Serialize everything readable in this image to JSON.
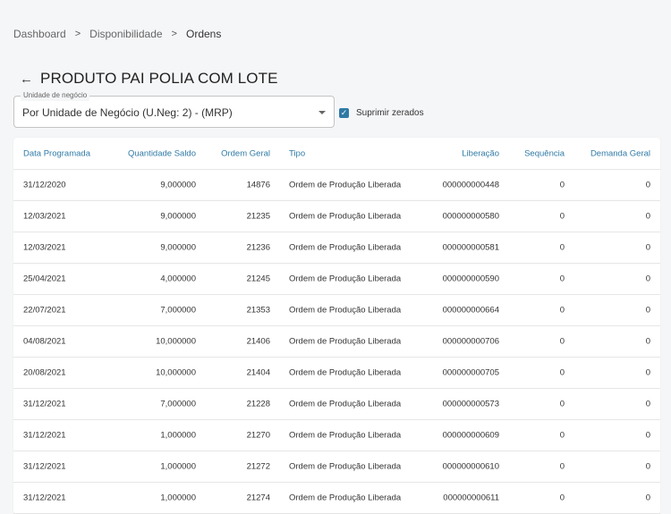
{
  "breadcrumb": [
    "Dashboard",
    "Disponibilidade",
    "Ordens"
  ],
  "page_title": "PRODUTO PAI POLIA COM LOTE",
  "unit_select": {
    "label": "Unidade de negócio",
    "value": "Por Unidade de Negócio (U.Neg: 2) - (MRP)"
  },
  "suppress_zero": {
    "label": "Suprimir zerados",
    "checked": true
  },
  "accent_color": "#2f7aa6",
  "table": {
    "headers": [
      "Data Programada",
      "Quantidade Saldo",
      "Ordem Geral",
      "Tipo",
      "Liberação",
      "Sequência",
      "Demanda Geral"
    ],
    "rows": [
      [
        "31/12/2020",
        "9,000000",
        "14876",
        "Ordem de Produção Liberada",
        "000000000448",
        "0",
        "0"
      ],
      [
        "12/03/2021",
        "9,000000",
        "21235",
        "Ordem de Produção Liberada",
        "000000000580",
        "0",
        "0"
      ],
      [
        "12/03/2021",
        "9,000000",
        "21236",
        "Ordem de Produção Liberada",
        "000000000581",
        "0",
        "0"
      ],
      [
        "25/04/2021",
        "4,000000",
        "21245",
        "Ordem de Produção Liberada",
        "000000000590",
        "0",
        "0"
      ],
      [
        "22/07/2021",
        "7,000000",
        "21353",
        "Ordem de Produção Liberada",
        "000000000664",
        "0",
        "0"
      ],
      [
        "04/08/2021",
        "10,000000",
        "21406",
        "Ordem de Produção Liberada",
        "000000000706",
        "0",
        "0"
      ],
      [
        "20/08/2021",
        "10,000000",
        "21404",
        "Ordem de Produção Liberada",
        "000000000705",
        "0",
        "0"
      ],
      [
        "31/12/2021",
        "7,000000",
        "21228",
        "Ordem de Produção Liberada",
        "000000000573",
        "0",
        "0"
      ],
      [
        "31/12/2021",
        "1,000000",
        "21270",
        "Ordem de Produção Liberada",
        "000000000609",
        "0",
        "0"
      ],
      [
        "31/12/2021",
        "1,000000",
        "21272",
        "Ordem de Produção Liberada",
        "000000000610",
        "0",
        "0"
      ],
      [
        "31/12/2021",
        "1,000000",
        "21274",
        "Ordem de Produção Liberada",
        "000000000611",
        "0",
        "0"
      ]
    ]
  }
}
